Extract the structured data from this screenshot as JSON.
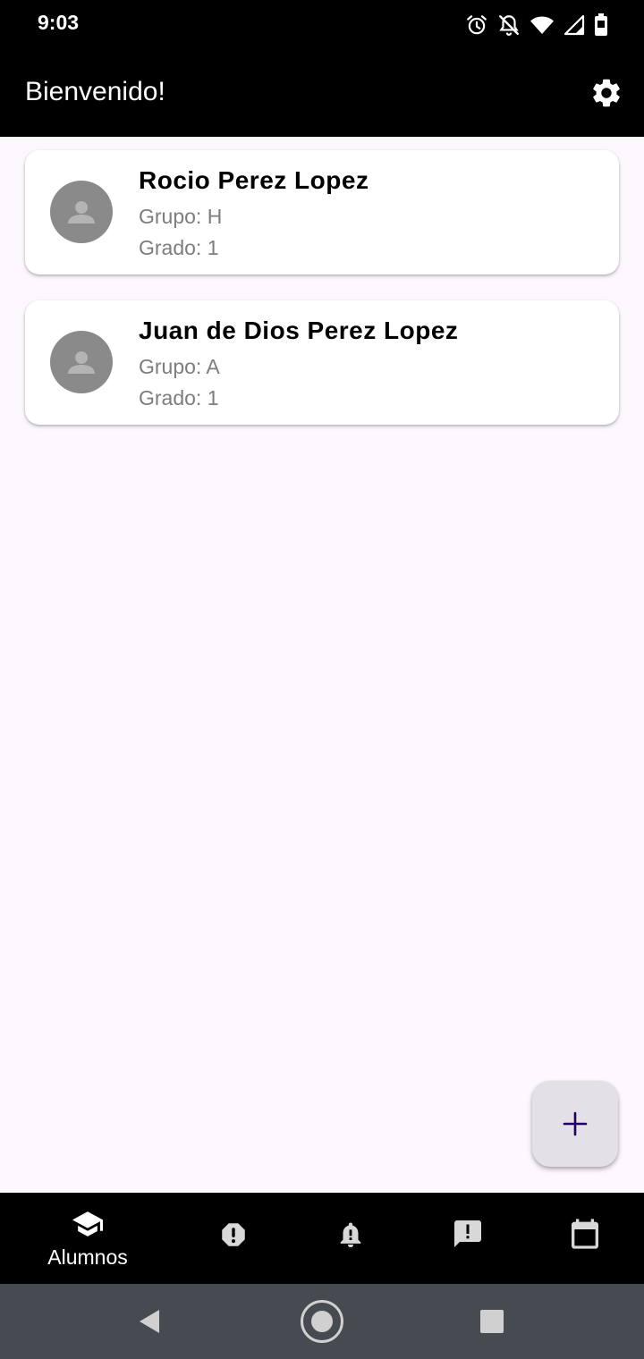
{
  "status_bar": {
    "time": "9:03",
    "icons": [
      "alarm-icon",
      "notifications-off-icon",
      "wifi-icon",
      "signal-icon",
      "battery-icon"
    ]
  },
  "app_bar": {
    "title": "Bienvenido!",
    "settings_icon": "gear-icon"
  },
  "students": [
    {
      "name": "Rocio Perez Lopez",
      "group": "Grupo: H",
      "grade": "Grado: 1"
    },
    {
      "name": "Juan de Dios Perez Lopez",
      "group": "Grupo: A",
      "grade": "Grado: 1"
    }
  ],
  "fab": {
    "icon": "plus-icon"
  },
  "bottom_nav": {
    "items": [
      {
        "label": "Alumnos",
        "icon": "school-icon",
        "active": true
      },
      {
        "label": "",
        "icon": "report-icon",
        "active": false
      },
      {
        "label": "",
        "icon": "notification-bell-icon",
        "active": false
      },
      {
        "label": "",
        "icon": "feedback-icon",
        "active": false
      },
      {
        "label": "",
        "icon": "calendar-icon",
        "active": false
      }
    ]
  },
  "system_nav": {
    "icons": [
      "back-icon",
      "home-icon",
      "recents-icon"
    ]
  },
  "colors": {
    "background": "#fdf7fe",
    "app_bar": "#000000",
    "card": "#ffffff",
    "avatar": "#8a8a8a",
    "secondary_text": "#7d7d7d",
    "fab_background": "#e4e0e7",
    "fab_icon": "#21005d",
    "system_nav": "#454b51"
  }
}
